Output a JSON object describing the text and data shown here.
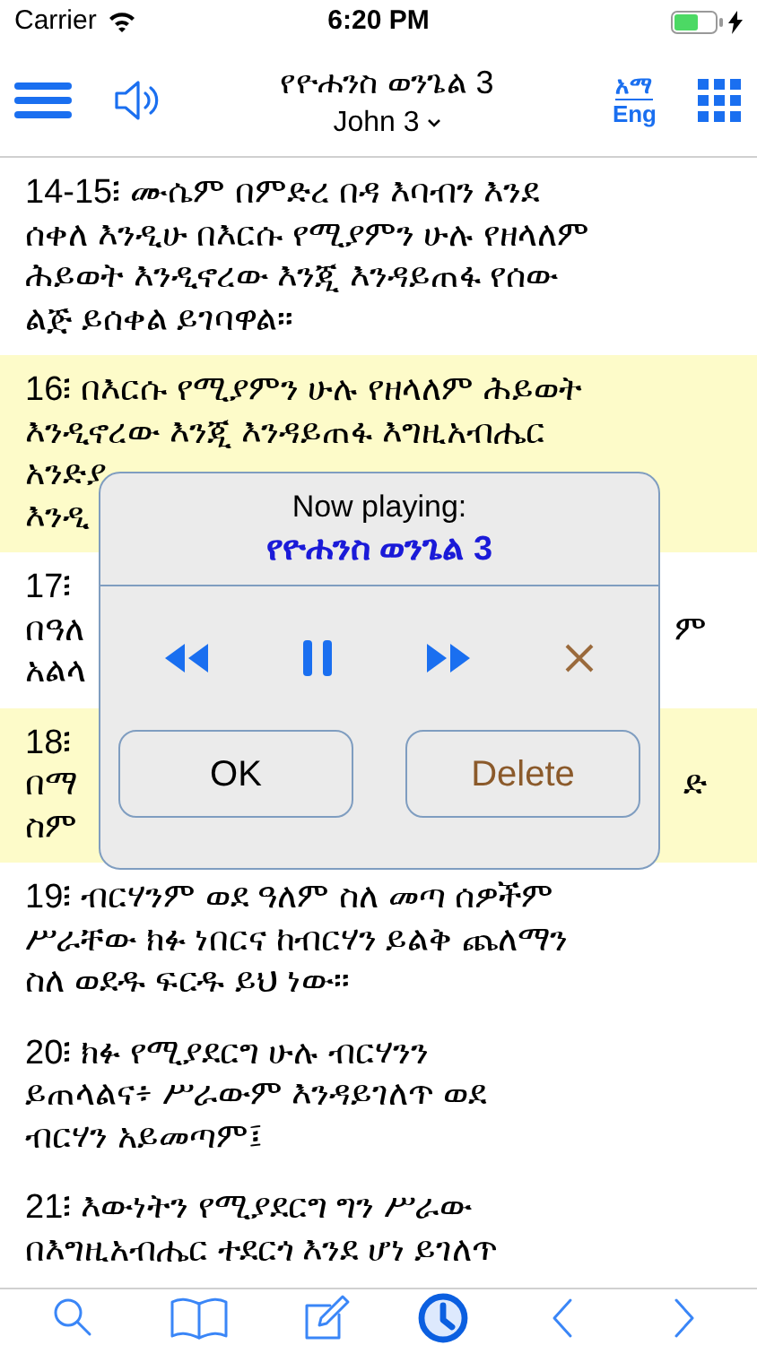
{
  "status_bar": {
    "carrier": "Carrier",
    "time": "6:20 PM"
  },
  "nav": {
    "title": "የዮሐንስ ወንጌል 3",
    "subtitle": "John 3",
    "language_top": "አማ",
    "language_bottom": "Eng"
  },
  "verses": [
    {
      "number": "14-15፧",
      "highlighted": false,
      "lines": [
        [
          "ሙሴም በምድረ በዳ እባብን እንደ"
        ],
        [
          "ሰቀለ እንዲሁ በእርሱ የሚያምን ሁሉ የዘላለም"
        ],
        [
          "ሕይወት እንዲኖረው እንጂ እንዳይጠፋ የሰው"
        ],
        [
          "ልጅ ይሰቀል ይገባዋል።"
        ]
      ]
    },
    {
      "number": "16፧",
      "highlighted": true,
      "lines": [
        [
          "በእርሱ የሚያምን ሁሉ የዘላለም ሕይወት"
        ],
        [
          "እንዲኖረው እንጂ እንዳይጠፋ እግዚአብሔር"
        ],
        [
          "አንድያ"
        ],
        [
          "እንዲ"
        ]
      ]
    },
    {
      "number": "17፧",
      "number_alone": true,
      "highlighted": false,
      "lines": [
        [
          "በዓለ",
          "ም"
        ],
        [
          "አልላ"
        ]
      ]
    },
    {
      "number": "18፧",
      "number_alone": true,
      "highlighted": true,
      "lines": [
        [
          "በማ",
          "ድ"
        ],
        [
          "ስም"
        ]
      ]
    },
    {
      "number": "19፧",
      "highlighted": false,
      "lines": [
        [
          "ብርሃንም ወደ ዓለም ስለ መጣ ሰዎችም"
        ],
        [
          "ሥራቸው ክፉ ነበርና ከብርሃን ይልቅ ጨለማን"
        ],
        [
          "ስለ ወደዱ ፍርዱ ይህ ነው።"
        ]
      ]
    },
    {
      "number": "20፧",
      "highlighted": false,
      "lines": [
        [
          "ክፉ የሚያደርግ ሁሉ ብርሃንን"
        ],
        [
          "ይጠላልና፥ ሥራውም እንዳይገለጥ ወደ"
        ],
        [
          "ብርሃን አይመጣም፤"
        ]
      ]
    },
    {
      "number": "21፧",
      "highlighted": false,
      "lines": [
        [
          "እውነትን የሚያደርግ ግን ሥራው"
        ],
        [
          "በእግዚአብሔር ተደርጎ እንደ ሆነ ይገለጥ"
        ]
      ]
    }
  ],
  "player": {
    "heading": "Now playing:",
    "title": "የዮሐንስ ወንጌል 3",
    "playing": true,
    "buttons": [
      {
        "label": "OK",
        "kind": "confirm"
      },
      {
        "label": "Delete",
        "kind": "destructive"
      }
    ]
  },
  "toolbar": [
    {
      "kind": "search",
      "selected": false
    },
    {
      "kind": "book",
      "selected": false
    },
    {
      "kind": "edit",
      "selected": false
    },
    {
      "kind": "history",
      "selected": true
    },
    {
      "kind": "back",
      "selected": false
    },
    {
      "kind": "forward",
      "selected": false
    }
  ]
}
